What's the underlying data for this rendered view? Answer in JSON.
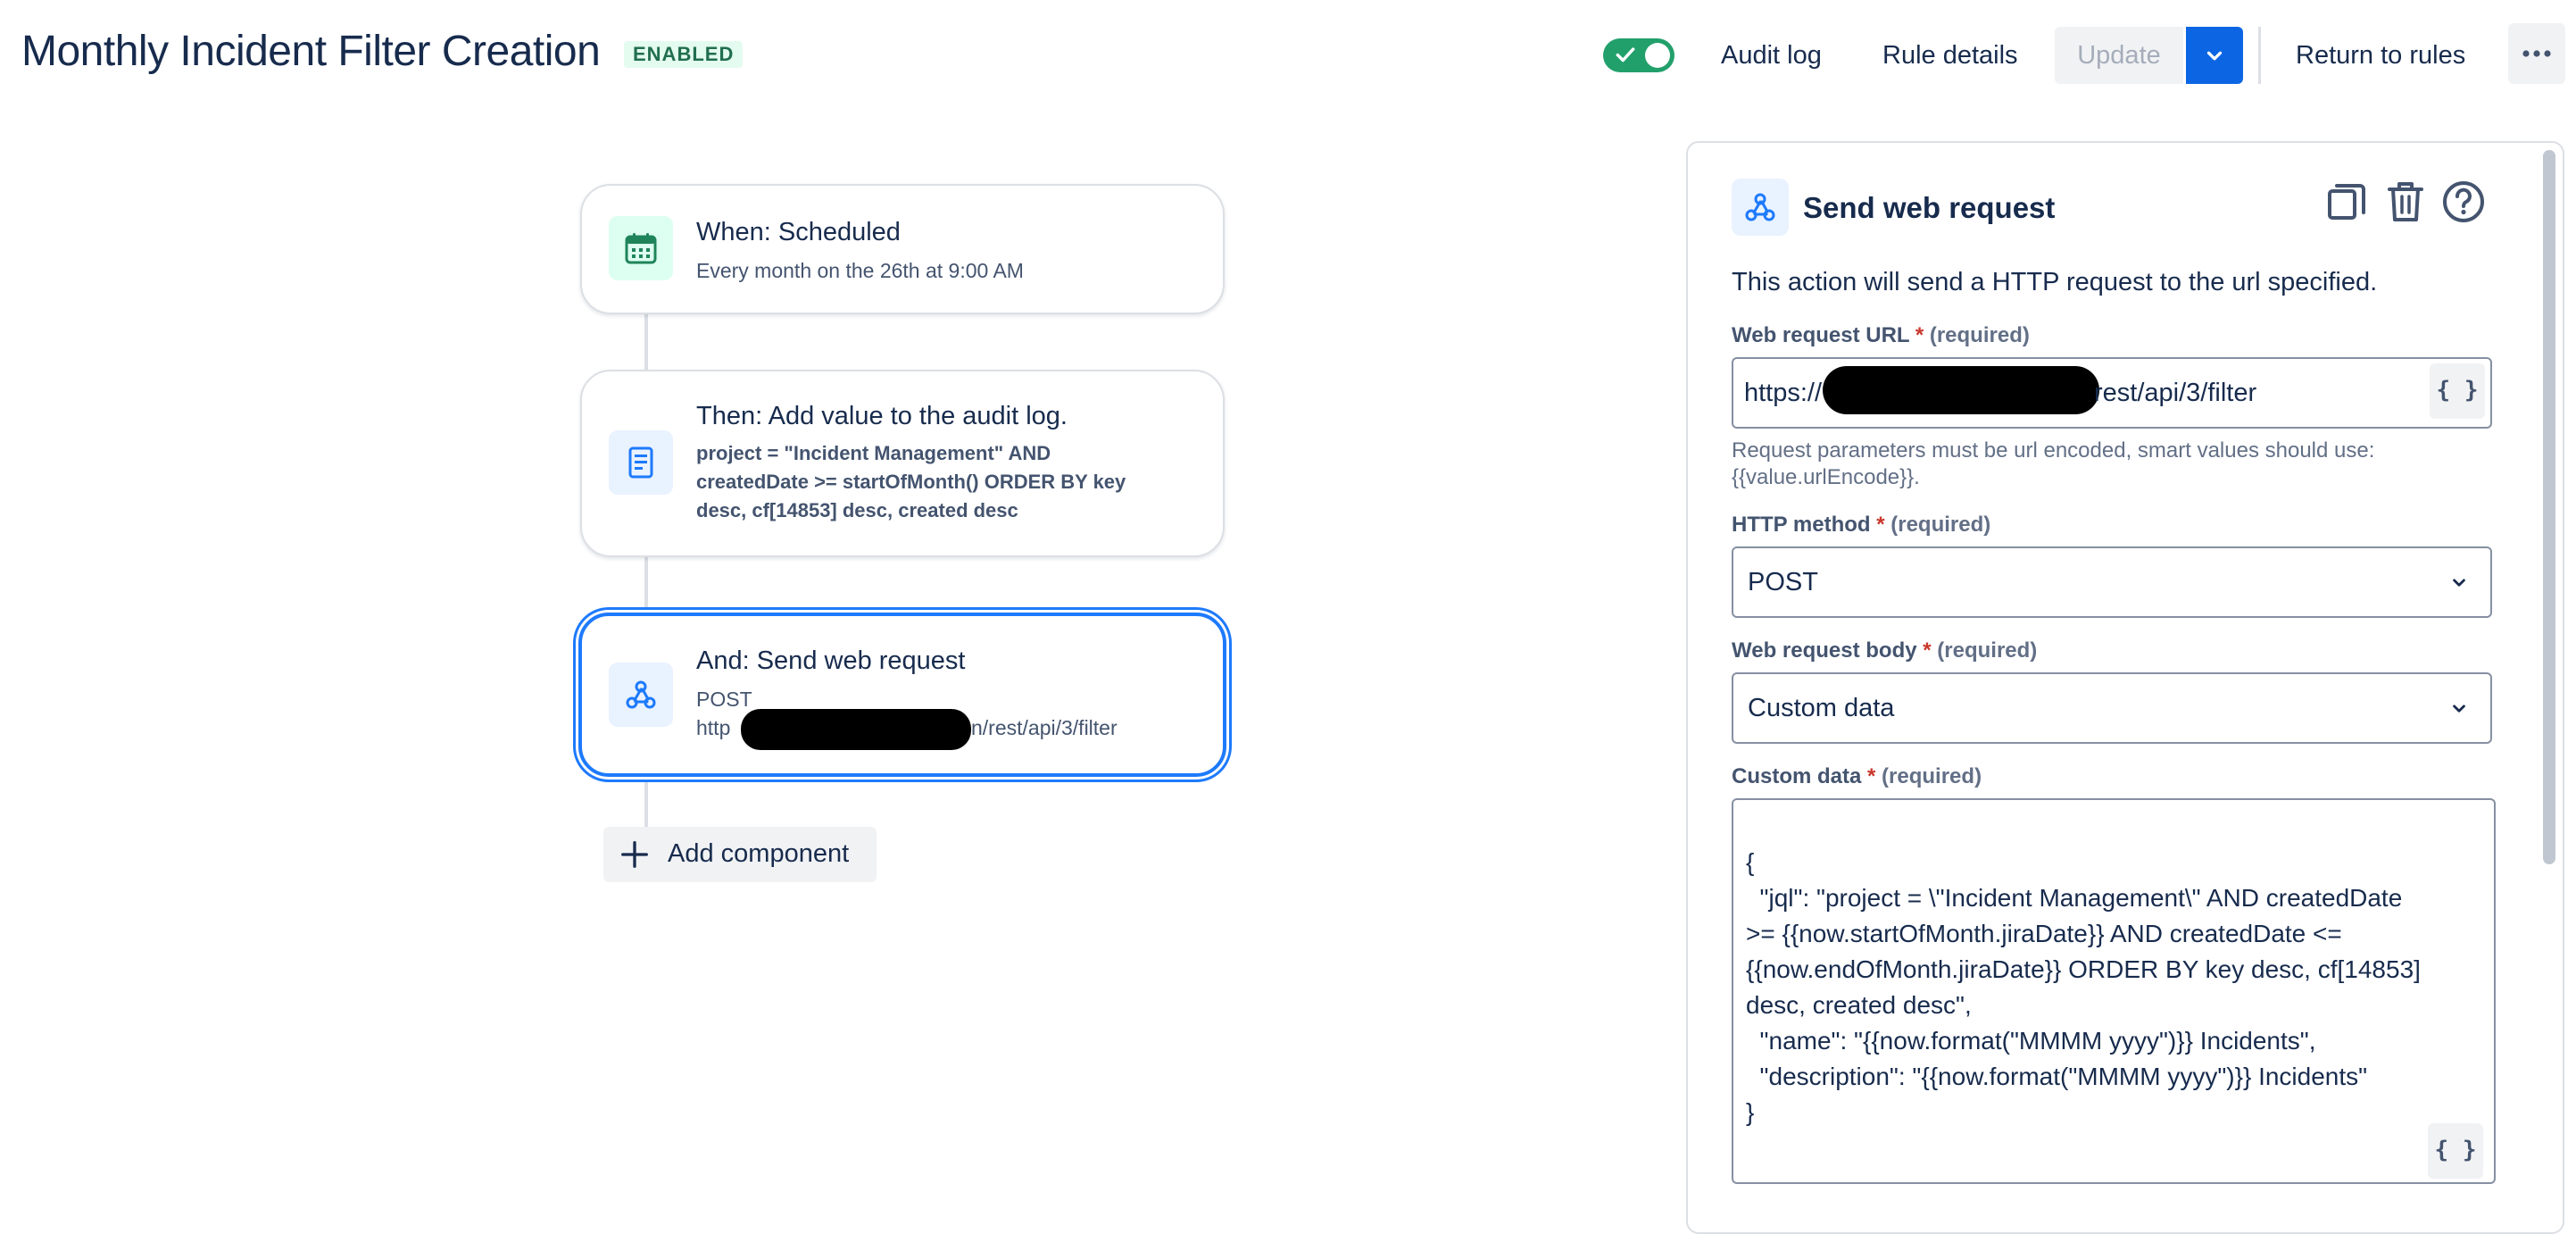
{
  "header": {
    "title": "Monthly Incident Filter Creation",
    "status": "ENABLED",
    "toggle_on": true,
    "audit_log": "Audit log",
    "rule_details": "Rule details",
    "update": "Update",
    "return_to_rules": "Return to rules"
  },
  "flow": {
    "trigger": {
      "title": "When: Scheduled",
      "subtitle": "Every month on the 26th at 9:00 AM"
    },
    "action1": {
      "title": "Then: Add value to the audit log.",
      "code_lines": [
        "project = \"Incident Management\" AND",
        "createdDate >= startOfMonth() ORDER BY key",
        "desc, cf[14853] desc, created desc"
      ]
    },
    "action2": {
      "title": "And: Send web request",
      "method": "POST",
      "url_prefix": "http",
      "url_suffix": "n/rest/api/3/filter"
    },
    "add_component": "Add component"
  },
  "panel": {
    "title": "Send web request",
    "description": "This action will send a HTTP request to the url specified.",
    "url_field": {
      "label": "Web request URL",
      "required_mark": "*",
      "required_text": "(required)",
      "value_prefix": "https://",
      "value_suffix": "rest/api/3/filter",
      "helper_lines": [
        "Request parameters must be url encoded, smart values should use:",
        "{{value.urlEncode}}."
      ]
    },
    "method_field": {
      "label": "HTTP method",
      "required_mark": "*",
      "required_text": "(required)",
      "value": "POST"
    },
    "body_field": {
      "label": "Web request body",
      "required_mark": "*",
      "required_text": "(required)",
      "value": "Custom data"
    },
    "custom_data_field": {
      "label": "Custom data",
      "required_mark": "*",
      "required_text": "(required)",
      "lines": [
        "{",
        "  \"jql\": \"project = \\\"Incident Management\\\" AND createdDate",
        ">= {{now.startOfMonth.jiraDate}} AND createdDate <=",
        "{{now.endOfMonth.jiraDate}} ORDER BY key desc, cf[14853]",
        "desc, created desc\",",
        "  \"name\": \"{{now.format(\"MMMM yyyy\")}} Incidents\",",
        "  \"description\": \"{{now.format(\"MMMM yyyy\")}} Incidents\"",
        "}"
      ]
    },
    "smart_value_button": "{ }"
  },
  "icons": {
    "toggle_check": "check-icon",
    "update_caret": "chevron-down-icon",
    "more": "more-horizontal-icon",
    "trigger": "calendar-icon",
    "audit_action": "document-icon",
    "web_request_action": "webhook-icon",
    "add": "plus-icon",
    "copy": "copy-icon",
    "delete": "trash-icon",
    "help": "help-icon"
  },
  "colors": {
    "accent": "#0c66e4",
    "selected_border": "#1d7afc",
    "toggle_on": "#22a06b",
    "enabled_lozenge_bg": "#e3fcef",
    "enabled_lozenge_text": "#216e4e",
    "required": "#c9372c"
  }
}
